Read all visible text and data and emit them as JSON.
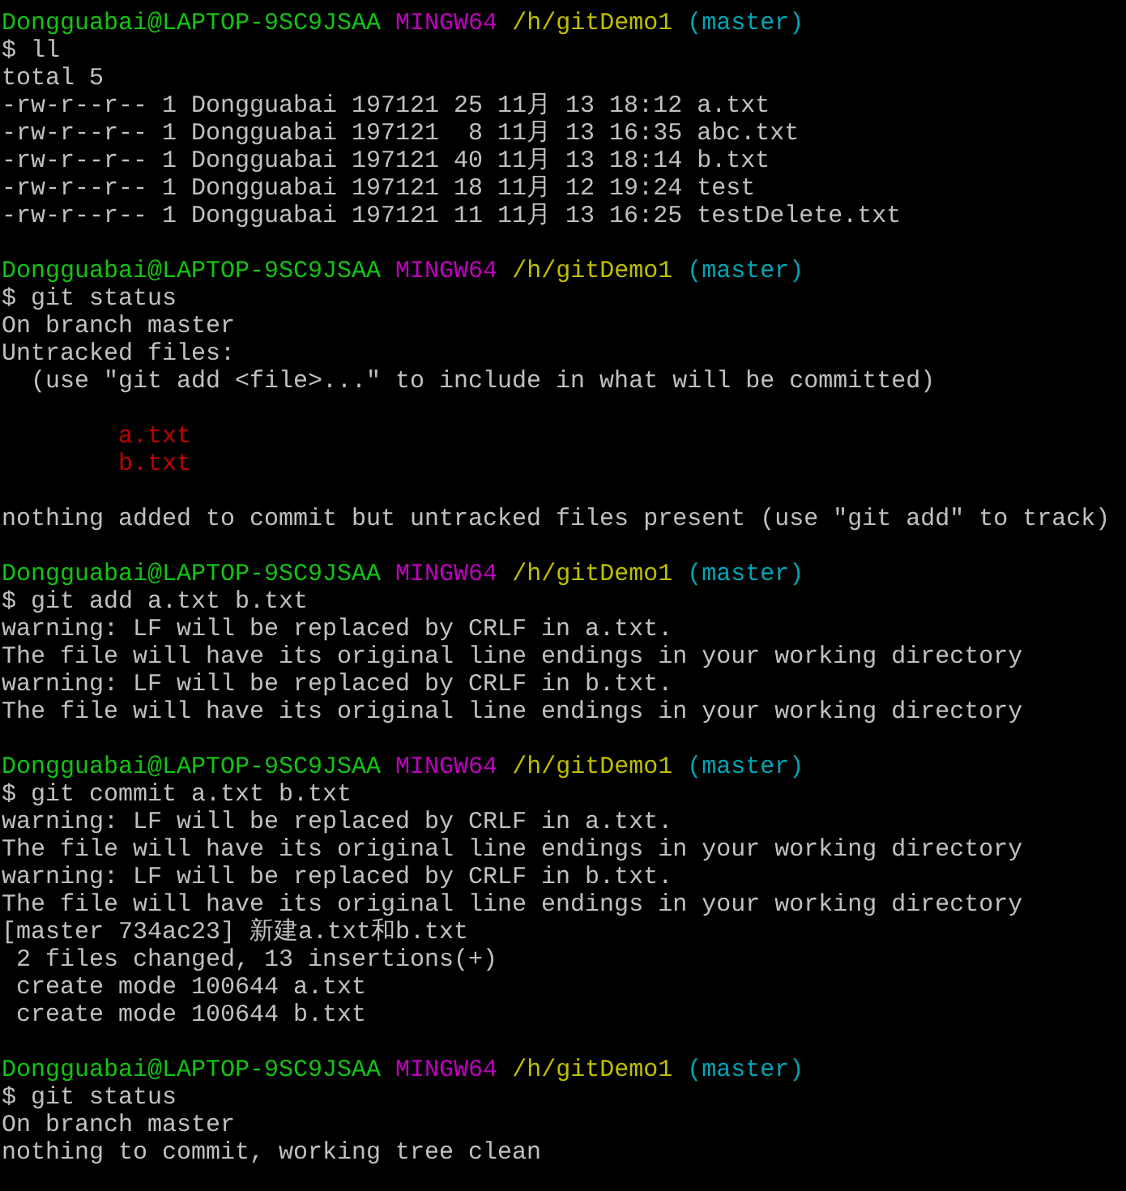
{
  "terminal": {
    "lines": [
      {
        "kind": "prompt",
        "user": "Dongguabai@LAPTOP-9SC9JSAA",
        "system": "MINGW64",
        "path": "/h/gitDemo1",
        "branch": "(master)"
      },
      {
        "kind": "command",
        "text": "$ ll"
      },
      {
        "kind": "output",
        "text": "total 5"
      },
      {
        "kind": "output",
        "text": "-rw-r--r-- 1 Dongguabai 197121 25 11月 13 18:12 a.txt"
      },
      {
        "kind": "output",
        "text": "-rw-r--r-- 1 Dongguabai 197121  8 11月 13 16:35 abc.txt"
      },
      {
        "kind": "output",
        "text": "-rw-r--r-- 1 Dongguabai 197121 40 11月 13 18:14 b.txt"
      },
      {
        "kind": "output",
        "text": "-rw-r--r-- 1 Dongguabai 197121 18 11月 12 19:24 test"
      },
      {
        "kind": "output",
        "text": "-rw-r--r-- 1 Dongguabai 197121 11 11月 13 16:25 testDelete.txt"
      },
      {
        "kind": "blank"
      },
      {
        "kind": "prompt",
        "user": "Dongguabai@LAPTOP-9SC9JSAA",
        "system": "MINGW64",
        "path": "/h/gitDemo1",
        "branch": "(master)"
      },
      {
        "kind": "command",
        "text": "$ git status"
      },
      {
        "kind": "output",
        "text": "On branch master"
      },
      {
        "kind": "output",
        "text": "Untracked files:"
      },
      {
        "kind": "output",
        "text": "  (use \"git add <file>...\" to include in what will be committed)"
      },
      {
        "kind": "blank"
      },
      {
        "kind": "untracked",
        "text": "a.txt"
      },
      {
        "kind": "untracked",
        "text": "b.txt"
      },
      {
        "kind": "blank"
      },
      {
        "kind": "output",
        "text": "nothing added to commit but untracked files present (use \"git add\" to track)"
      },
      {
        "kind": "blank"
      },
      {
        "kind": "prompt",
        "user": "Dongguabai@LAPTOP-9SC9JSAA",
        "system": "MINGW64",
        "path": "/h/gitDemo1",
        "branch": "(master)"
      },
      {
        "kind": "command",
        "text": "$ git add a.txt b.txt"
      },
      {
        "kind": "output",
        "text": "warning: LF will be replaced by CRLF in a.txt."
      },
      {
        "kind": "output",
        "text": "The file will have its original line endings in your working directory"
      },
      {
        "kind": "output",
        "text": "warning: LF will be replaced by CRLF in b.txt."
      },
      {
        "kind": "output",
        "text": "The file will have its original line endings in your working directory"
      },
      {
        "kind": "blank"
      },
      {
        "kind": "prompt",
        "user": "Dongguabai@LAPTOP-9SC9JSAA",
        "system": "MINGW64",
        "path": "/h/gitDemo1",
        "branch": "(master)"
      },
      {
        "kind": "command",
        "text": "$ git commit a.txt b.txt"
      },
      {
        "kind": "output",
        "text": "warning: LF will be replaced by CRLF in a.txt."
      },
      {
        "kind": "output",
        "text": "The file will have its original line endings in your working directory"
      },
      {
        "kind": "output",
        "text": "warning: LF will be replaced by CRLF in b.txt."
      },
      {
        "kind": "output",
        "text": "The file will have its original line endings in your working directory"
      },
      {
        "kind": "output",
        "text": "[master 734ac23] 新建a.txt和b.txt"
      },
      {
        "kind": "output",
        "text": " 2 files changed, 13 insertions(+)"
      },
      {
        "kind": "output",
        "text": " create mode 100644 a.txt"
      },
      {
        "kind": "output",
        "text": " create mode 100644 b.txt"
      },
      {
        "kind": "blank"
      },
      {
        "kind": "prompt",
        "user": "Dongguabai@LAPTOP-9SC9JSAA",
        "system": "MINGW64",
        "path": "/h/gitDemo1",
        "branch": "(master)"
      },
      {
        "kind": "command",
        "text": "$ git status"
      },
      {
        "kind": "output",
        "text": "On branch master"
      },
      {
        "kind": "output",
        "text": "nothing to commit, working tree clean"
      }
    ]
  }
}
